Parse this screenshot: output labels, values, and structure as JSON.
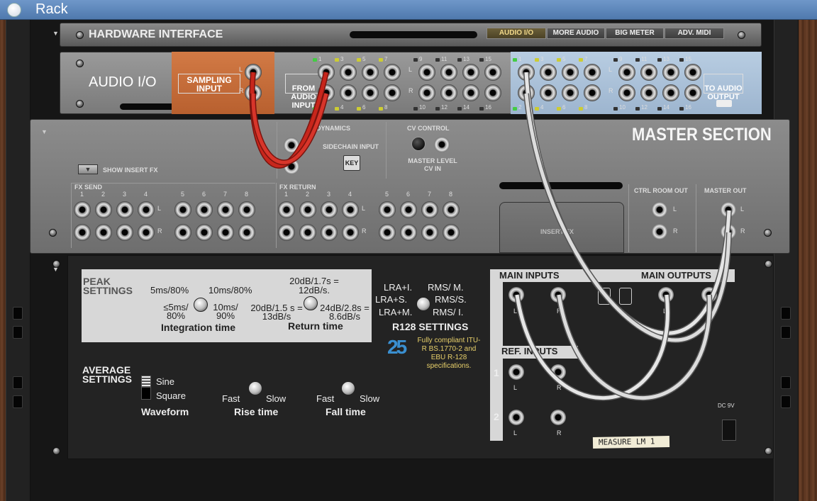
{
  "window": {
    "title": "Rack"
  },
  "hardware": {
    "title": "HARDWARE INTERFACE",
    "buttons": [
      "AUDIO I/O",
      "MORE AUDIO",
      "BIG METER",
      "ADV. MIDI"
    ]
  },
  "audio_io": {
    "title": "AUDIO I/O",
    "sampling_input": "SAMPLING INPUT",
    "from_audio_input": "FROM AUDIO INPUT",
    "to_audio_output": "TO AUDIO OUTPUT",
    "odd_channels": [
      "1",
      "3",
      "5",
      "7",
      "9",
      "11",
      "13",
      "15"
    ],
    "even_channels": [
      "2",
      "4",
      "6",
      "8",
      "10",
      "12",
      "14",
      "16"
    ],
    "l": "L",
    "r": "R"
  },
  "master": {
    "title": "MASTER SECTION",
    "dynamics": "DYNAMICS",
    "sidechain_input": "SIDECHAIN INPUT",
    "key": "KEY",
    "cv_control": "CV CONTROL",
    "master_level_cv_in": "MASTER LEVEL CV IN",
    "show_insert_fx": "SHOW INSERT FX",
    "fx_send": "FX SEND",
    "fx_return": "FX RETURN",
    "fx_numbers": [
      "1",
      "2",
      "3",
      "4",
      "5",
      "6",
      "7",
      "8"
    ],
    "insert_fx": "INSERT FX",
    "ctrl_room_out": "CTRL ROOM OUT",
    "master_out": "MASTER OUT",
    "l": "L",
    "r": "R"
  },
  "lm1": {
    "peak_settings": "PEAK SETTINGS",
    "integration": {
      "opt_5ms": "5ms/80%",
      "opt_10ms": "10ms/80%",
      "opt_le5": "≤5ms/ 80%",
      "opt_10ms90": "10ms/ 90%",
      "label": "Integration time"
    },
    "return_opts": {
      "top": "20dB/1.7s = 12dB/s.",
      "left": "20dB/1.5 s = 13dB/s",
      "right": "24dB/2.8s = 8.6dB/s",
      "label": "Return time"
    },
    "r128": {
      "lra_i": "LRA+I.",
      "rms_m": "RMS/ M.",
      "lra_s": "LRA+S.",
      "rms_s": "RMS/S.",
      "lra_m": "LRA+M.",
      "rms_i": "RMS/ I.",
      "title": "R128 SETTINGS"
    },
    "compliance_logo": "25",
    "compliance": "Fully compliant ITU-R BS.1770-2 and EBU R-128 specifications.",
    "average_settings": "AVERAGE SETTINGS",
    "waveform": {
      "sine": "Sine",
      "square": "Square",
      "label": "Waveform"
    },
    "rise": {
      "fast": "Fast",
      "slow": "Slow",
      "label": "Rise time"
    },
    "fall": {
      "fast": "Fast",
      "slow": "Slow",
      "label": "Fall time"
    },
    "main_inputs": "MAIN INPUTS",
    "main_outputs": "MAIN OUTPUTS",
    "ref_inputs": "REF. INPUTS",
    "ref_numbers": [
      "1",
      "2"
    ],
    "dc": "DC 9V",
    "name_tape": "MEASURE LM 1",
    "l": "L",
    "r": "R"
  },
  "colors": {
    "cable_red": "#c8261c",
    "cable_white": "#e6e6e6",
    "audio_io_blue": "#a9c0d8",
    "sampling_orange": "#c9703f"
  }
}
